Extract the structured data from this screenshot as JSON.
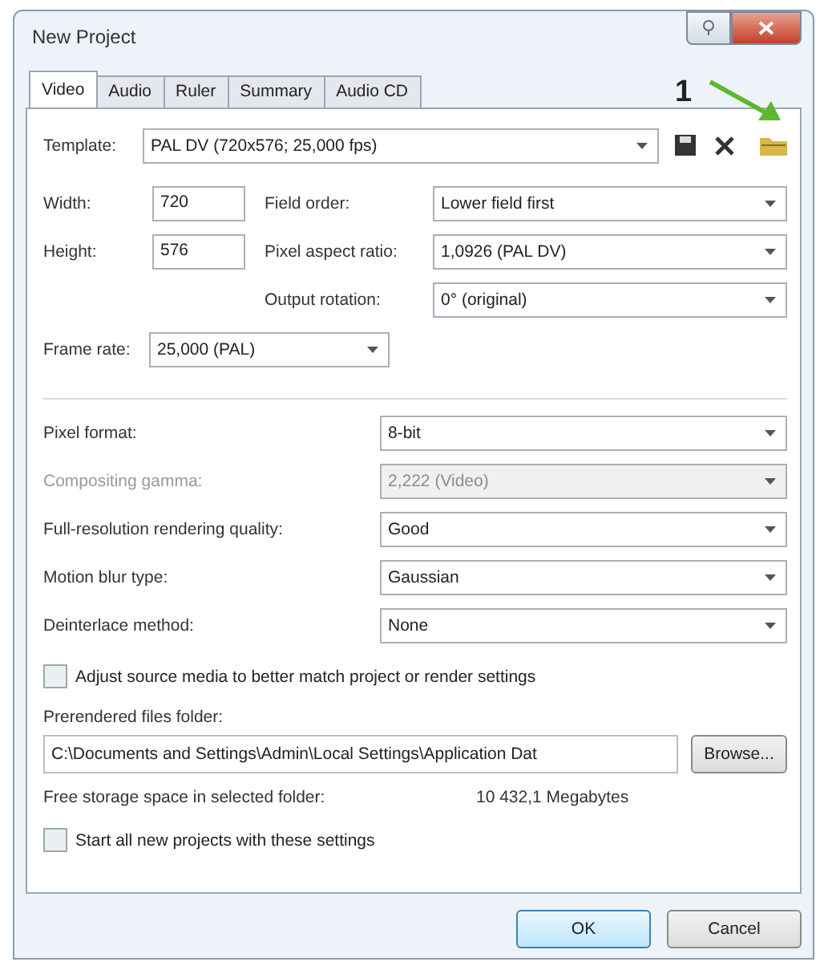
{
  "window": {
    "title": "New Project"
  },
  "tabs": [
    {
      "label": "Video",
      "selected": true
    },
    {
      "label": "Audio",
      "selected": false
    },
    {
      "label": "Ruler",
      "selected": false
    },
    {
      "label": "Summary",
      "selected": false
    },
    {
      "label": "Audio CD",
      "selected": false
    }
  ],
  "annotation": {
    "label": "1"
  },
  "template": {
    "label": "Template:",
    "value": "PAL DV (720x576; 25,000 fps)"
  },
  "size_fields": [
    {
      "label": "Width:",
      "value": "720"
    },
    {
      "label": "Height:",
      "value": "576"
    }
  ],
  "format_fields": [
    {
      "label": "Field order:",
      "value": "Lower field first"
    },
    {
      "label": "Pixel aspect ratio:",
      "value": "1,0926 (PAL DV)"
    },
    {
      "label": "Output rotation:",
      "value": "0° (original)"
    }
  ],
  "frame_rate": {
    "label": "Frame rate:",
    "value": "25,000 (PAL)"
  },
  "settings": [
    {
      "label": "Pixel format:",
      "value": "8-bit",
      "disabled": false
    },
    {
      "label": "Compositing gamma:",
      "value": "2,222 (Video)",
      "disabled": true
    },
    {
      "label": "Full-resolution rendering quality:",
      "value": "Good",
      "disabled": false
    },
    {
      "label": "Motion blur type:",
      "value": "Gaussian",
      "disabled": false
    },
    {
      "label": "Deinterlace method:",
      "value": "None",
      "disabled": false
    }
  ],
  "adjust_source": {
    "label": "Adjust source media to better match project or render settings",
    "checked": false
  },
  "prerender": {
    "label": "Prerendered files folder:",
    "value": "C:\\Documents and Settings\\Admin\\Local Settings\\Application Dat",
    "button": "Browse..."
  },
  "storage": {
    "label": "Free storage space in selected folder:",
    "value": "10 432,1 Megabytes"
  },
  "start_all": {
    "label": "Start all new projects with these settings",
    "checked": false
  },
  "buttons": [
    {
      "label": "OK",
      "kind": "default"
    },
    {
      "label": "Cancel",
      "kind": "normal"
    }
  ]
}
